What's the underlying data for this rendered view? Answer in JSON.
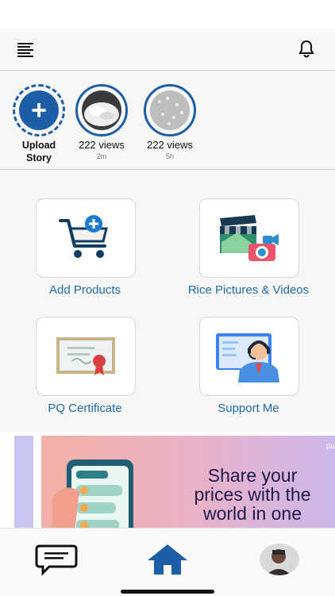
{
  "header": {
    "menu_icon": "menu-icon",
    "bell_icon": "bell-icon"
  },
  "stories": [
    {
      "label": "Upload\nStory",
      "time": "",
      "icon": "plus-icon"
    },
    {
      "label": "222 views",
      "time": "2m"
    },
    {
      "label": "222 views",
      "time": "5h"
    }
  ],
  "tiles": [
    {
      "label": "Add Products",
      "icon": "cart-add-icon"
    },
    {
      "label": "Rice Pictures & Videos",
      "icon": "media-icon"
    },
    {
      "label": "PQ Certificate",
      "icon": "certificate-icon"
    },
    {
      "label": "Support Me",
      "icon": "support-agent-icon"
    }
  ],
  "banner": {
    "text_line1": "Share your",
    "text_line2": "prices with the",
    "text_line3": "world in one",
    "logo": "pu"
  },
  "bottom_nav": {
    "chat_icon": "chat-icon",
    "home_icon": "home-icon",
    "profile_icon": "avatar"
  },
  "colors": {
    "accent": "#1c5fa6",
    "tile_label": "#1d6aa8",
    "background": "#f7f7f7"
  }
}
